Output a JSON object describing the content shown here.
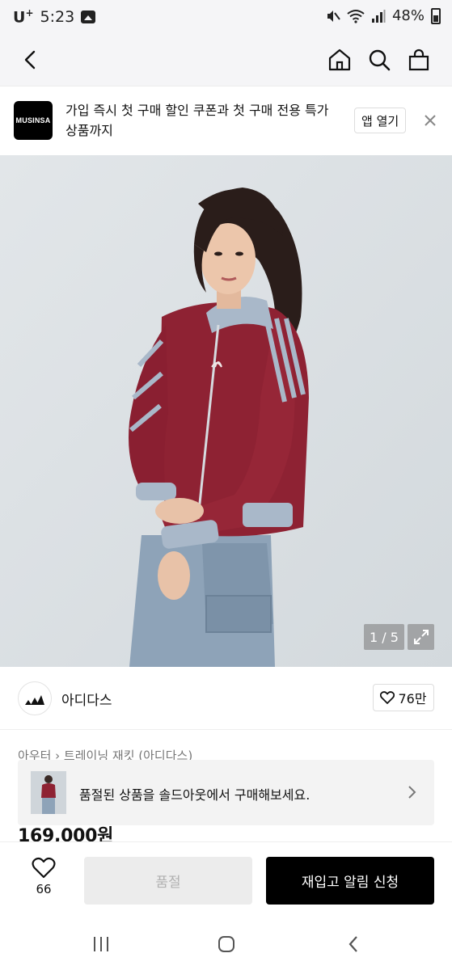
{
  "status_bar": {
    "carrier": "U",
    "carrier_sup": "+",
    "time": "5:23",
    "battery": "48%"
  },
  "nav": {
    "icons": [
      "back-icon",
      "home-icon",
      "search-icon",
      "shopping-bag-icon"
    ]
  },
  "app_banner": {
    "logo_text": "MUSINSA",
    "message": "가입 즉시 첫 구매 할인 쿠폰과 첫 구매 전용 특가 상품까지",
    "open_label": "앱 열기"
  },
  "gallery": {
    "counter": "1 / 5"
  },
  "brand": {
    "name": "아디다스",
    "likes": "76만"
  },
  "category_trail": "아우터 › 트레이닝 재킷 (아디다스)",
  "soldout_notice": "품절된 상품을 솔드아웃에서 구매해보세요.",
  "price": "169,000원",
  "bottom_bar": {
    "wish_count": "66",
    "soldout_label": "품절",
    "restock_label": "재입고 알림 신청"
  },
  "colors": {
    "accent": "#000000",
    "jacket": "#8e2233",
    "stripe": "#a9b8c9",
    "background": "#dfe3e6"
  }
}
